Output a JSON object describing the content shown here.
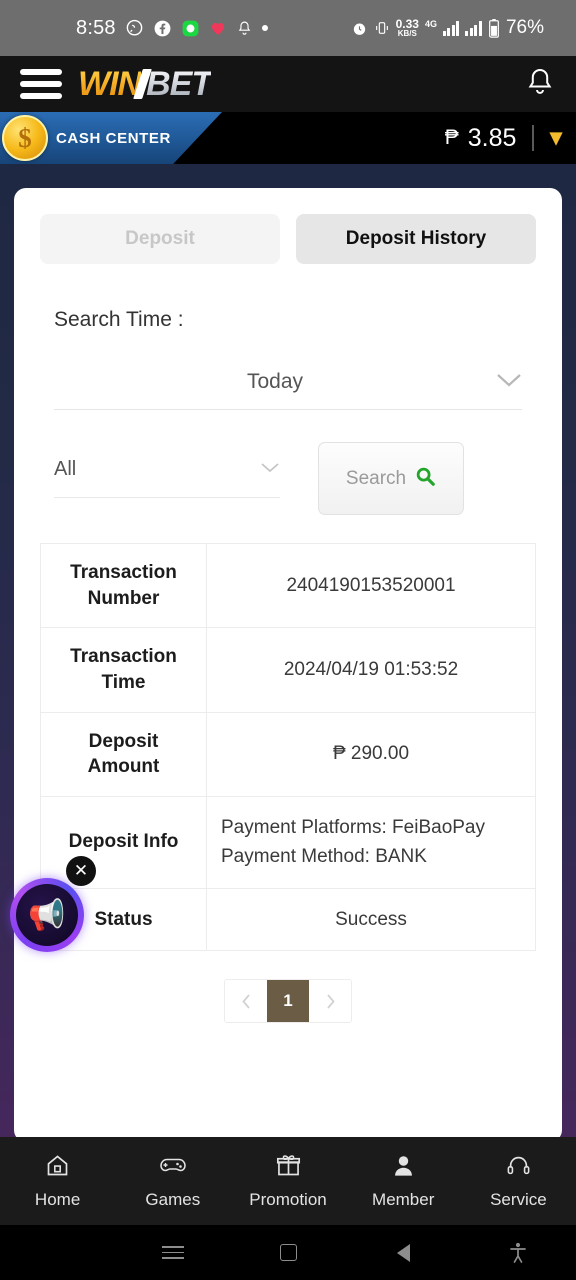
{
  "status_bar": {
    "time": "8:58",
    "left_icons": [
      "viber-icon",
      "facebook-icon",
      "messenger-green-icon",
      "heart-icon",
      "bell-icon",
      "dot-icon"
    ],
    "network_speed_value": "0.33",
    "network_speed_unit": "KB/S",
    "network_type": "4G",
    "battery_percent": "76%",
    "right_icons": [
      "alarm-icon",
      "vibrate-icon",
      "signal-bars-icon",
      "signal-bars-2-icon",
      "battery-icon"
    ]
  },
  "app_header": {
    "menu_icon": "hamburger-icon",
    "logo_win": "WIN",
    "logo_bet": "BET",
    "notification_icon": "bell-icon"
  },
  "cash_bar": {
    "coin_symbol": "$",
    "title": "CASH CENTER",
    "currency_symbol": "₱",
    "balance": "3.85",
    "expand_icon": "chevron-down-icon"
  },
  "tabs": {
    "deposit": "Deposit",
    "deposit_history": "Deposit History",
    "active": "Deposit History"
  },
  "filters": {
    "search_time_label": "Search Time :",
    "date_range_value": "Today",
    "type_value": "All",
    "search_button_label": "Search",
    "search_icon": "magnifier-icon"
  },
  "transaction": {
    "rows": [
      {
        "label": "Transaction Number",
        "value": "2404190153520001",
        "align": "center"
      },
      {
        "label": "Transaction Time",
        "value": "2024/04/19 01:53:52",
        "align": "center"
      },
      {
        "label": "Deposit Amount",
        "value": "₱ 290.00",
        "align": "center"
      },
      {
        "label": "Deposit Info",
        "value_line1": "Payment Platforms: FeiBaoPay",
        "value_line2": "Payment Method: BANK",
        "align": "left"
      },
      {
        "label": "Status",
        "value": "Success",
        "align": "center"
      }
    ]
  },
  "pagination": {
    "prev_icon": "chevron-left-icon",
    "current_page": "1",
    "next_icon": "chevron-right-icon"
  },
  "float_widget": {
    "icon": "megaphone-icon",
    "glyph": "📢",
    "close_icon": "close-icon",
    "close_glyph": "✕"
  },
  "bottom_nav": {
    "items": [
      {
        "label": "Home",
        "icon": "home-icon"
      },
      {
        "label": "Games",
        "icon": "gamepad-icon"
      },
      {
        "label": "Promotion",
        "icon": "gift-icon"
      },
      {
        "label": "Member",
        "icon": "person-icon"
      },
      {
        "label": "Service",
        "icon": "headset-icon"
      }
    ]
  },
  "android_nav": {
    "recents_icon": "recents-icon",
    "home_icon": "home-square-icon",
    "back_icon": "back-triangle-icon",
    "accessibility_icon": "accessibility-icon"
  },
  "colors": {
    "accent_gold": "#f3bc2e",
    "banner_blue": "#1f5896",
    "search_green": "#22a52a",
    "page_active": "#6b5c46"
  }
}
